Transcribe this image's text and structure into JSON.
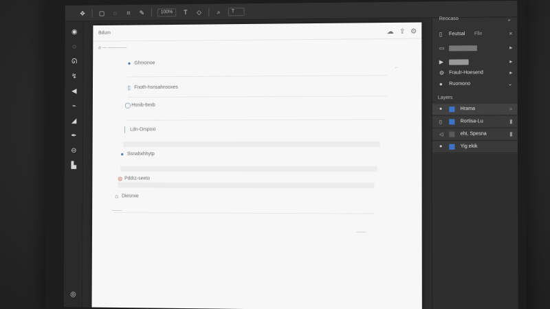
{
  "topbar": {
    "icons": [
      "move-icon",
      "marquee-icon",
      "lasso-icon",
      "crop-icon",
      "brush-icon",
      "text-icon",
      "shape-icon",
      "zoom-icon"
    ],
    "field_1": "100%",
    "field_2": "T"
  },
  "tools": {
    "items": [
      "move-tool",
      "marquee-tool",
      "lasso-tool",
      "wand-tool",
      "crop-tool",
      "brush-tool",
      "eraser-tool",
      "pen-tool",
      "text-tool",
      "shape-tool",
      "hand-tool"
    ]
  },
  "document": {
    "header_title": "Bdum",
    "header_sub": "a — ————",
    "items": [
      {
        "label": "Ghrxonoe"
      },
      {
        "label": "Fnoth-hsnsahnsoxes"
      },
      {
        "label": "Hsnib-ttexb"
      },
      {
        "label": "Ldn-Orspoxi"
      },
      {
        "label": "Ssnahxhhytp"
      },
      {
        "label": "Pddrz-seeto"
      },
      {
        "label": "Diesnxe"
      }
    ],
    "footer_mark": "——"
  },
  "panel": {
    "header": "Reocaso",
    "props": [
      {
        "label": "Feutsal",
        "value": "Flle"
      },
      {
        "label": "Frodasio",
        "value": ""
      },
      {
        "label": "Fnoa",
        "value": ""
      },
      {
        "label": "Fraulr-Hoesend",
        "value": ""
      },
      {
        "label": "Ruomono",
        "value": ""
      }
    ],
    "layers_title": "Layers",
    "layers": [
      {
        "name": "Hrama"
      },
      {
        "name": "Rortisa-Lu"
      },
      {
        "name": "ehL Spesna"
      },
      {
        "name": "Yig ekik"
      }
    ]
  }
}
